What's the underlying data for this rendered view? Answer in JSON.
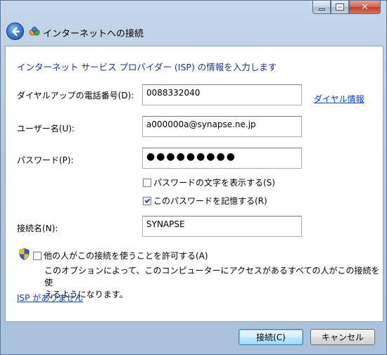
{
  "window": {
    "title": "インターネットへの接続"
  },
  "form": {
    "heading": "インターネット サービス プロバイダー (ISP) の情報を入力します",
    "phone_label": "ダイヤルアップの電話番号(D):",
    "phone_value": "0088332040",
    "dial_info_link": "ダイヤル情報",
    "user_label": "ユーザー名(U):",
    "user_value": "a000000a@synapse.ne.jp",
    "password_label": "パスワード(P):",
    "password_value": "●●●●●●●●●",
    "show_chars_label": "パスワードの文字を表示する(S)",
    "show_chars_checked": false,
    "remember_label": "このパスワードを記憶する(R)",
    "remember_checked": true,
    "conn_name_label": "接続名(N):",
    "conn_name_value": "SYNAPSE",
    "allow_others_label": "他の人がこの接続を使うことを許可する(A)",
    "allow_others_checked": false,
    "allow_desc_line1": "このオプションによって、このコンピューターにアクセスがあるすべての人がこの接続を使",
    "allow_desc_line2": "えるようになります。",
    "no_isp_link": "ISP がありません"
  },
  "footer": {
    "connect_label": "接続(C)",
    "cancel_label": "キャンセル"
  },
  "colors": {
    "heading": "#1e3287",
    "link": "#0a40c4"
  }
}
